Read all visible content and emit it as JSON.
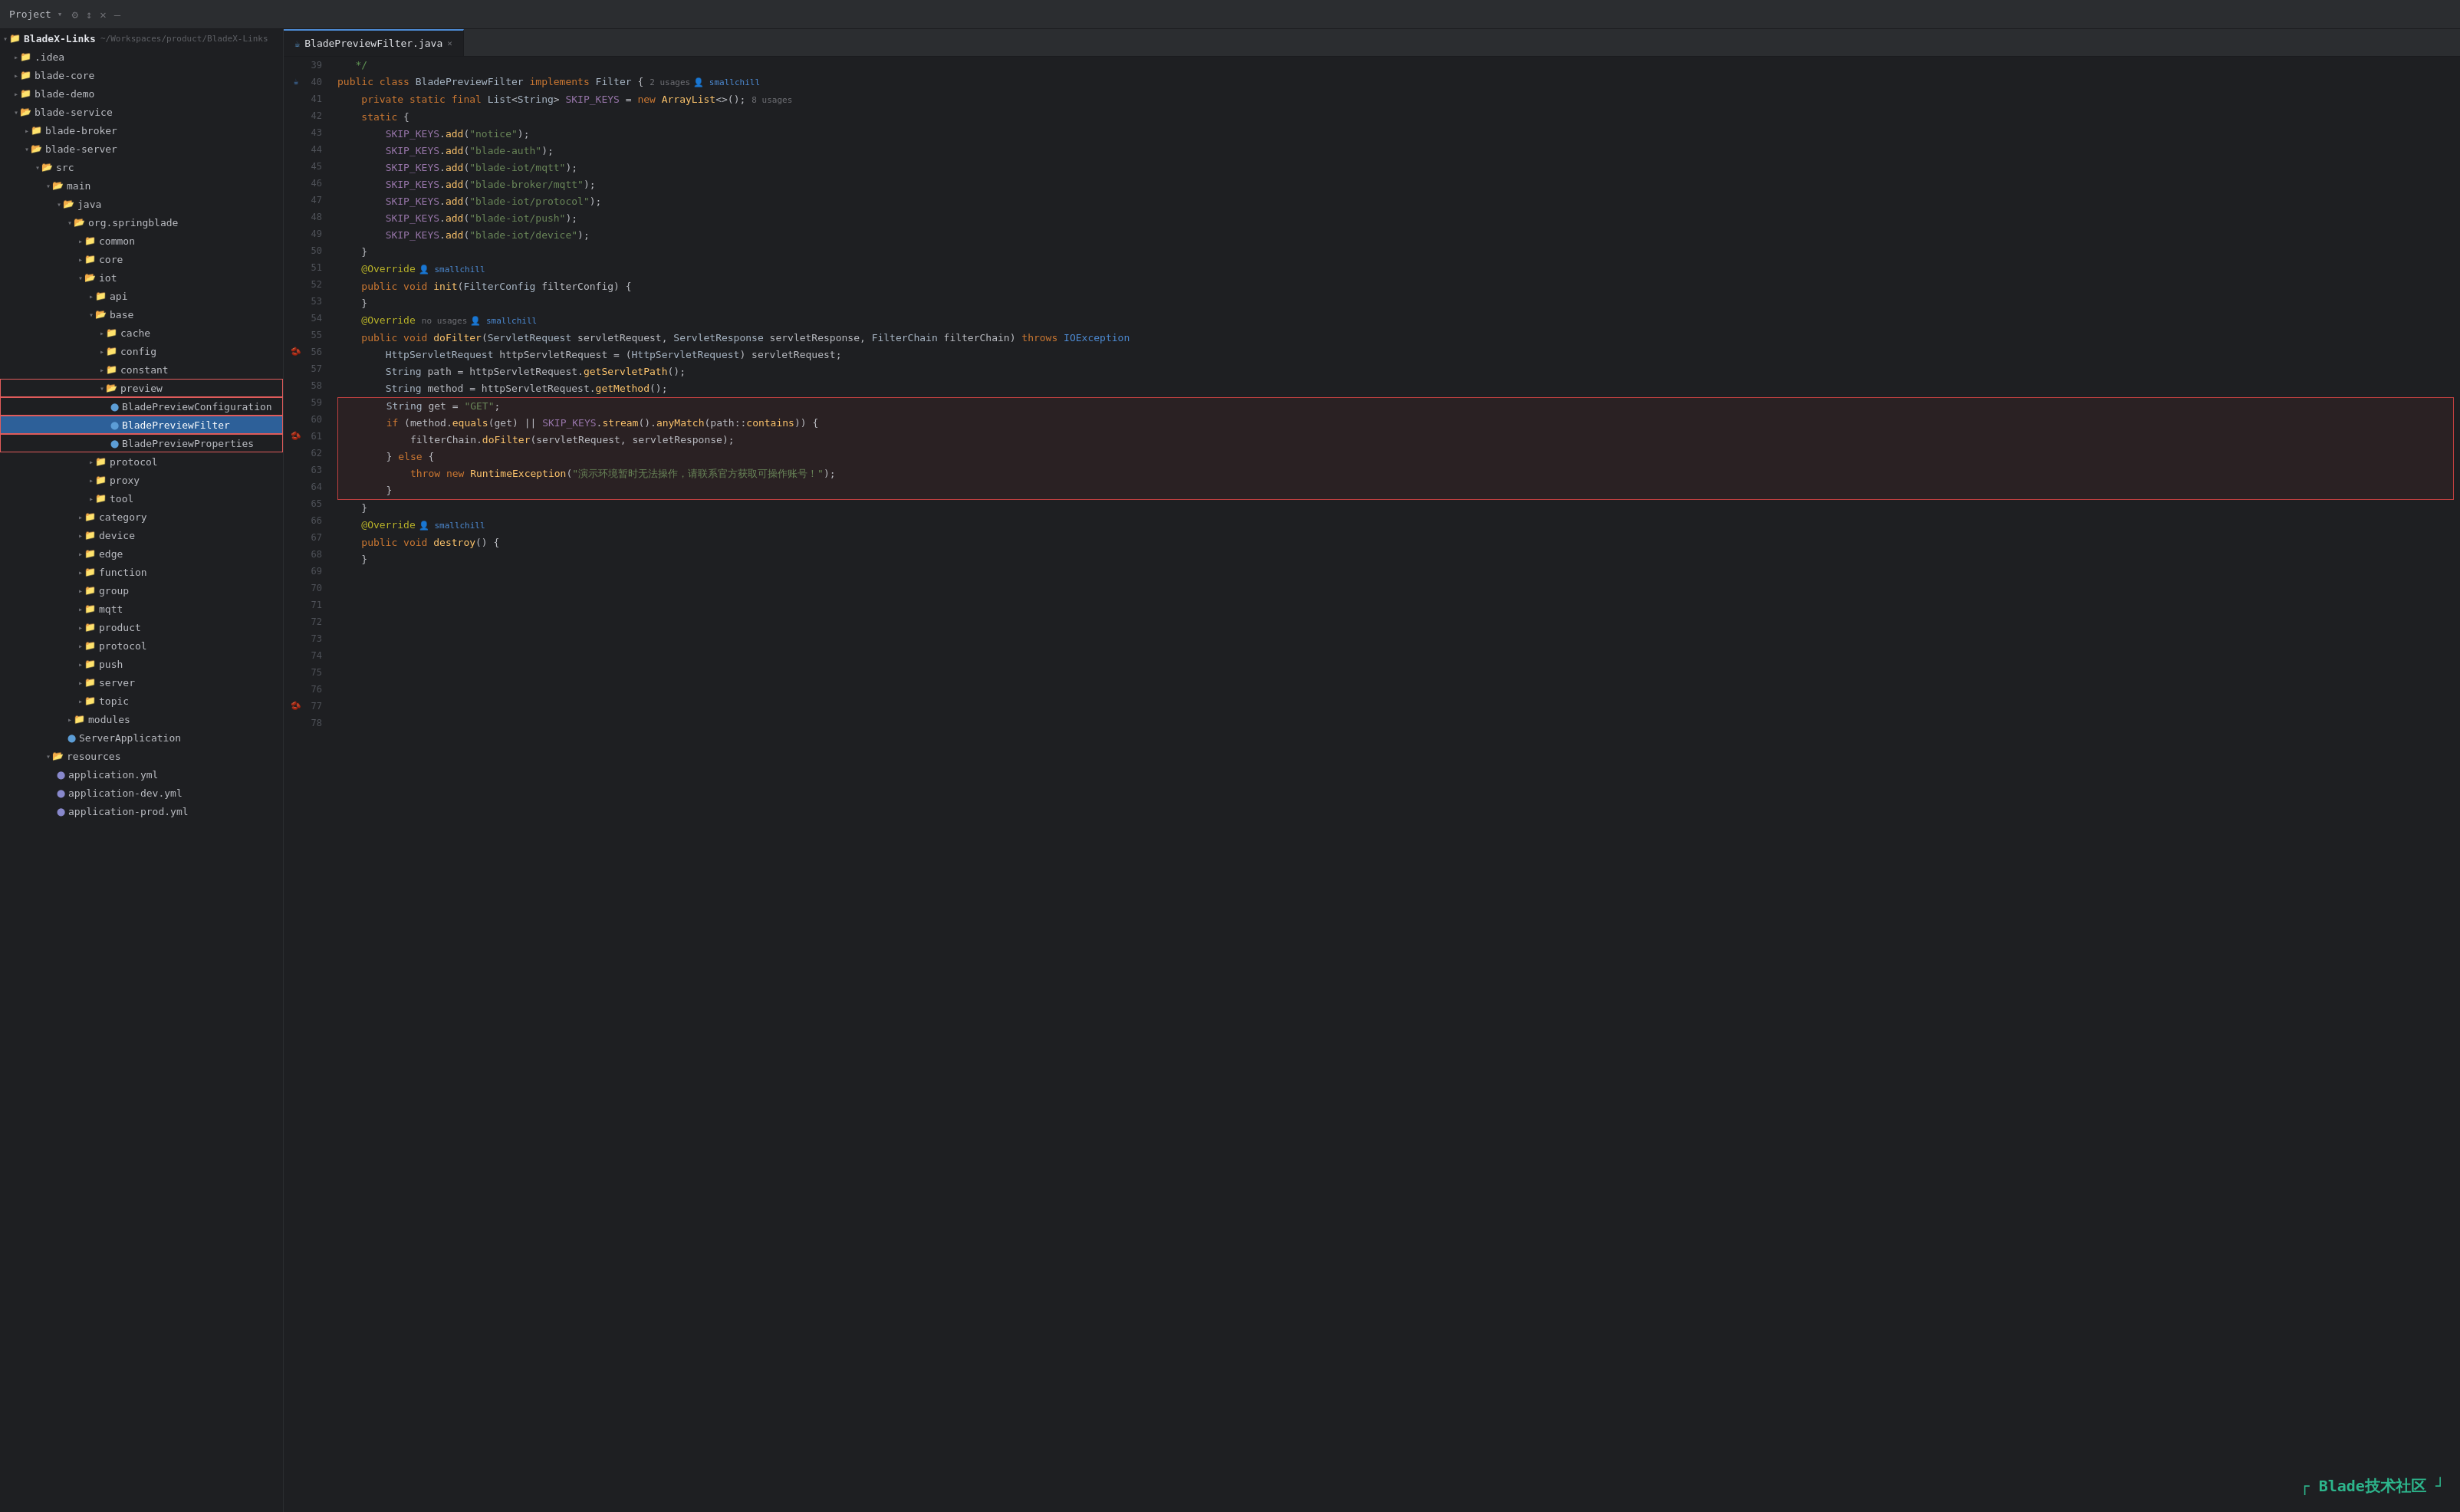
{
  "titleBar": {
    "projectLabel": "Project",
    "dropdownArrow": "▾",
    "icons": [
      "⚙",
      "↕",
      "✕",
      "—"
    ]
  },
  "sidebar": {
    "items": [
      {
        "id": "bladex-links",
        "label": "BladeX-Links",
        "subtitle": "~/Workspaces/product/BladeX-Links",
        "indent": 0,
        "type": "root",
        "expanded": true
      },
      {
        "id": "idea",
        "label": ".idea",
        "indent": 1,
        "type": "folder",
        "expanded": false
      },
      {
        "id": "blade-core",
        "label": "blade-core",
        "indent": 1,
        "type": "folder",
        "expanded": false
      },
      {
        "id": "blade-demo",
        "label": "blade-demo",
        "indent": 1,
        "type": "folder",
        "expanded": false
      },
      {
        "id": "blade-service",
        "label": "blade-service",
        "indent": 1,
        "type": "folder",
        "expanded": true
      },
      {
        "id": "blade-broker",
        "label": "blade-broker",
        "indent": 2,
        "type": "folder",
        "expanded": false
      },
      {
        "id": "blade-server",
        "label": "blade-server",
        "indent": 2,
        "type": "folder",
        "expanded": true
      },
      {
        "id": "src",
        "label": "src",
        "indent": 3,
        "type": "folder",
        "expanded": true
      },
      {
        "id": "main",
        "label": "main",
        "indent": 4,
        "type": "folder",
        "expanded": true
      },
      {
        "id": "java",
        "label": "java",
        "indent": 5,
        "type": "folder",
        "expanded": true
      },
      {
        "id": "org-springblade",
        "label": "org.springblade",
        "indent": 6,
        "type": "folder",
        "expanded": true
      },
      {
        "id": "common",
        "label": "common",
        "indent": 7,
        "type": "folder",
        "expanded": false
      },
      {
        "id": "core",
        "label": "core",
        "indent": 7,
        "type": "folder",
        "expanded": false
      },
      {
        "id": "iot",
        "label": "iot",
        "indent": 7,
        "type": "folder",
        "expanded": true
      },
      {
        "id": "api",
        "label": "api",
        "indent": 8,
        "type": "folder",
        "expanded": false
      },
      {
        "id": "base",
        "label": "base",
        "indent": 8,
        "type": "folder",
        "expanded": true
      },
      {
        "id": "cache",
        "label": "cache",
        "indent": 9,
        "type": "folder",
        "expanded": false
      },
      {
        "id": "config",
        "label": "config",
        "indent": 9,
        "type": "folder",
        "expanded": false
      },
      {
        "id": "constant",
        "label": "constant",
        "indent": 9,
        "type": "folder",
        "expanded": false
      },
      {
        "id": "preview",
        "label": "preview",
        "indent": 9,
        "type": "folder",
        "expanded": true,
        "highlighted": true
      },
      {
        "id": "BladePreviewConfiguration",
        "label": "BladePreviewConfiguration",
        "indent": 10,
        "type": "file-java",
        "highlighted": true
      },
      {
        "id": "BladePreviewFilter",
        "label": "BladePreviewFilter",
        "indent": 10,
        "type": "file-java",
        "active": true,
        "highlighted": true
      },
      {
        "id": "BladePreviewProperties",
        "label": "BladePreviewProperties",
        "indent": 10,
        "type": "file-java",
        "highlighted": true
      },
      {
        "id": "protocol",
        "label": "protocol",
        "indent": 8,
        "type": "folder",
        "expanded": false
      },
      {
        "id": "proxy",
        "label": "proxy",
        "indent": 8,
        "type": "folder",
        "expanded": false
      },
      {
        "id": "tool",
        "label": "tool",
        "indent": 8,
        "type": "folder",
        "expanded": false
      },
      {
        "id": "category",
        "label": "category",
        "indent": 7,
        "type": "folder",
        "expanded": false
      },
      {
        "id": "device",
        "label": "device",
        "indent": 7,
        "type": "folder",
        "expanded": false
      },
      {
        "id": "edge",
        "label": "edge",
        "indent": 7,
        "type": "folder",
        "expanded": false
      },
      {
        "id": "function",
        "label": "function",
        "indent": 7,
        "type": "folder",
        "expanded": false
      },
      {
        "id": "group",
        "label": "group",
        "indent": 7,
        "type": "folder",
        "expanded": false
      },
      {
        "id": "mqtt",
        "label": "mqtt",
        "indent": 7,
        "type": "folder",
        "expanded": false
      },
      {
        "id": "product",
        "label": "product",
        "indent": 7,
        "type": "folder",
        "expanded": false
      },
      {
        "id": "protocol2",
        "label": "protocol",
        "indent": 7,
        "type": "folder",
        "expanded": false
      },
      {
        "id": "push",
        "label": "push",
        "indent": 7,
        "type": "folder",
        "expanded": false
      },
      {
        "id": "server",
        "label": "server",
        "indent": 7,
        "type": "folder",
        "expanded": false
      },
      {
        "id": "topic",
        "label": "topic",
        "indent": 7,
        "type": "folder",
        "expanded": false
      },
      {
        "id": "modules",
        "label": "modules",
        "indent": 6,
        "type": "folder",
        "expanded": false
      },
      {
        "id": "ServerApplication",
        "label": "ServerApplication",
        "indent": 6,
        "type": "file-java"
      },
      {
        "id": "resources",
        "label": "resources",
        "indent": 4,
        "type": "folder",
        "expanded": true
      },
      {
        "id": "application.yml",
        "label": "application.yml",
        "indent": 5,
        "type": "file-yml"
      },
      {
        "id": "application-dev.yml",
        "label": "application-dev.yml",
        "indent": 5,
        "type": "file-yml"
      },
      {
        "id": "application-prod.yml",
        "label": "application-prod.yml",
        "indent": 5,
        "type": "file-yml"
      }
    ]
  },
  "tabs": [
    {
      "id": "BladePreviewFilter",
      "label": "BladePreviewFilter.java",
      "active": true,
      "closeable": true
    }
  ],
  "editor": {
    "filename": "BladePreviewFilter.java",
    "lines": [
      {
        "num": 39,
        "content": "   */",
        "type": "normal"
      },
      {
        "num": 40,
        "content": "public class BladePreviewFilter implements Filter {",
        "type": "class-decl",
        "usages": "2 usages",
        "author": "smallchill"
      },
      {
        "num": 41,
        "content": "",
        "type": "normal"
      },
      {
        "num": 42,
        "content": "    private static final List<String> SKIP_KEYS = new ArrayList<>();",
        "type": "normal",
        "usages": "8 usages"
      },
      {
        "num": 43,
        "content": "",
        "type": "normal"
      },
      {
        "num": 44,
        "content": "    static {",
        "type": "normal"
      },
      {
        "num": 45,
        "content": "        SKIP_KEYS.add(\"notice\");",
        "type": "normal"
      },
      {
        "num": 46,
        "content": "        SKIP_KEYS.add(\"blade-auth\");",
        "type": "normal"
      },
      {
        "num": 47,
        "content": "        SKIP_KEYS.add(\"blade-iot/mqtt\");",
        "type": "normal"
      },
      {
        "num": 48,
        "content": "        SKIP_KEYS.add(\"blade-broker/mqtt\");",
        "type": "normal"
      },
      {
        "num": 49,
        "content": "        SKIP_KEYS.add(\"blade-iot/protocol\");",
        "type": "normal"
      },
      {
        "num": 50,
        "content": "        SKIP_KEYS.add(\"blade-iot/push\");",
        "type": "normal"
      },
      {
        "num": 51,
        "content": "        SKIP_KEYS.add(\"blade-iot/device\");",
        "type": "normal"
      },
      {
        "num": 52,
        "content": "    }",
        "type": "normal"
      },
      {
        "num": 53,
        "content": "",
        "type": "normal"
      },
      {
        "num": 54,
        "content": "",
        "type": "normal"
      },
      {
        "num": 55,
        "content": "    @Override",
        "type": "normal",
        "author": "smallchill"
      },
      {
        "num": 56,
        "content": "    public void init(FilterConfig filterConfig) {",
        "type": "method-decl",
        "gutter": "bean"
      },
      {
        "num": 57,
        "content": "    }",
        "type": "normal"
      },
      {
        "num": 58,
        "content": "",
        "type": "normal"
      },
      {
        "num": 59,
        "content": "",
        "type": "normal"
      },
      {
        "num": 60,
        "content": "    @Override",
        "type": "normal",
        "usages": "no usages",
        "author": "smallchill"
      },
      {
        "num": 61,
        "content": "    public void doFilter(ServletRequest servletRequest, ServletResponse servletResponse, FilterChain filterChain) throws IOException",
        "type": "method-decl",
        "gutter": "bean2"
      },
      {
        "num": 62,
        "content": "",
        "type": "normal"
      },
      {
        "num": 63,
        "content": "        HttpServletRequest httpServletRequest = (HttpServletRequest) servletRequest;",
        "type": "normal"
      },
      {
        "num": 64,
        "content": "        String path = httpServletRequest.getServletPath();",
        "type": "normal"
      },
      {
        "num": 65,
        "content": "        String method = httpServletRequest.getMethod();",
        "type": "normal"
      },
      {
        "num": 66,
        "content": "",
        "type": "normal"
      },
      {
        "num": 67,
        "content": "        String get = \"GET\";",
        "type": "highlighted"
      },
      {
        "num": 68,
        "content": "        if (method.equals(get) || SKIP_KEYS.stream().anyMatch(path::contains)) {",
        "type": "highlighted"
      },
      {
        "num": 69,
        "content": "            filterChain.doFilter(servletRequest, servletResponse);",
        "type": "highlighted"
      },
      {
        "num": 70,
        "content": "        } else {",
        "type": "highlighted"
      },
      {
        "num": 71,
        "content": "            throw new RuntimeException(\"演示环境暂时无法操作，请联系官方获取可操作账号！\");",
        "type": "highlighted"
      },
      {
        "num": 72,
        "content": "        }",
        "type": "highlighted"
      },
      {
        "num": 73,
        "content": "",
        "type": "highlighted-end"
      },
      {
        "num": 74,
        "content": "    }",
        "type": "normal"
      },
      {
        "num": 75,
        "content": "",
        "type": "normal"
      },
      {
        "num": 76,
        "content": "    @Override",
        "type": "normal",
        "author": "smallchill"
      },
      {
        "num": 77,
        "content": "    public void destroy() {",
        "type": "method-decl",
        "gutter": "bean3"
      },
      {
        "num": 78,
        "content": "    }",
        "type": "normal"
      }
    ]
  },
  "brand": {
    "text": "Blade技术社区",
    "cornerTL": "┌",
    "cornerBR": "┘"
  }
}
